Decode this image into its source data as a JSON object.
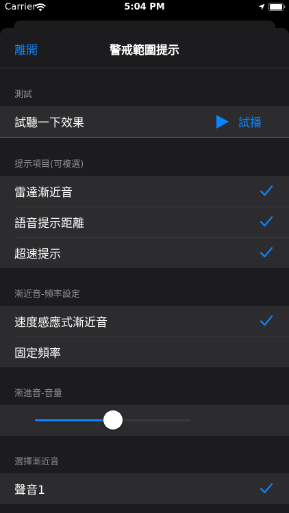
{
  "status_bar": {
    "carrier": "Carrier",
    "time": "5:04 PM"
  },
  "nav": {
    "left_label": "離開",
    "title": "警戒範圍提示"
  },
  "sections": {
    "test": {
      "header": "測試",
      "row_label": "試聽一下效果",
      "play_label": "試播"
    },
    "alerts": {
      "header": "提示項目(可複選)",
      "items": [
        {
          "label": "雷達漸近音",
          "checked": true
        },
        {
          "label": "語音提示距離",
          "checked": true
        },
        {
          "label": "超速提示",
          "checked": true
        }
      ]
    },
    "frequency": {
      "header": "漸近音-頻率設定",
      "items": [
        {
          "label": "速度感應式漸近音",
          "checked": true
        },
        {
          "label": "固定頻率",
          "checked": false
        }
      ]
    },
    "volume": {
      "header": "漸進音-音量",
      "value_fraction": 0.5
    },
    "sound": {
      "header": "選擇漸近音",
      "items": [
        {
          "label": "聲音1",
          "checked": true
        }
      ]
    }
  },
  "colors": {
    "accent": "#0a84ff",
    "background": "#1c1c1e",
    "cell": "#2c2c2e",
    "secondary_text": "#8e8e93"
  }
}
